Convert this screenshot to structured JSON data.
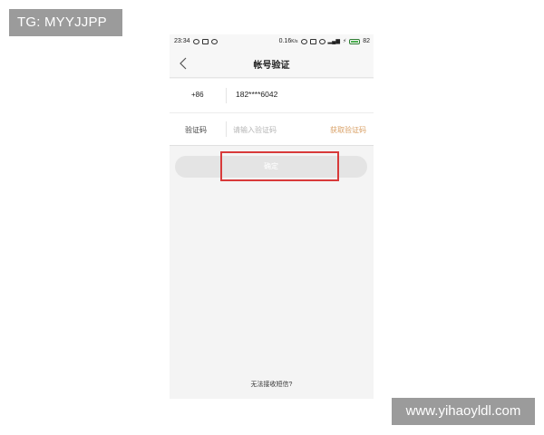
{
  "watermarks": {
    "top_left": "TG: MYYJJPP",
    "bottom_right": "www.yihaoyldl.com"
  },
  "status_bar": {
    "time": "23:34",
    "network_speed": "0.16",
    "network_unit": "K/s",
    "battery": "82"
  },
  "header": {
    "title": "帐号验证"
  },
  "form": {
    "country_code": "+86",
    "phone_number": "182****6042",
    "code_label": "验证码",
    "code_placeholder": "请输入验证码",
    "get_code_label": "获取验证码",
    "confirm_label": "确定"
  },
  "footer": {
    "help_link": "无法接收短信?"
  },
  "colors": {
    "accent": "#d9a066",
    "highlight": "#d83a3a",
    "button_disabled": "#e4e4e4",
    "background": "#f4f4f4"
  }
}
